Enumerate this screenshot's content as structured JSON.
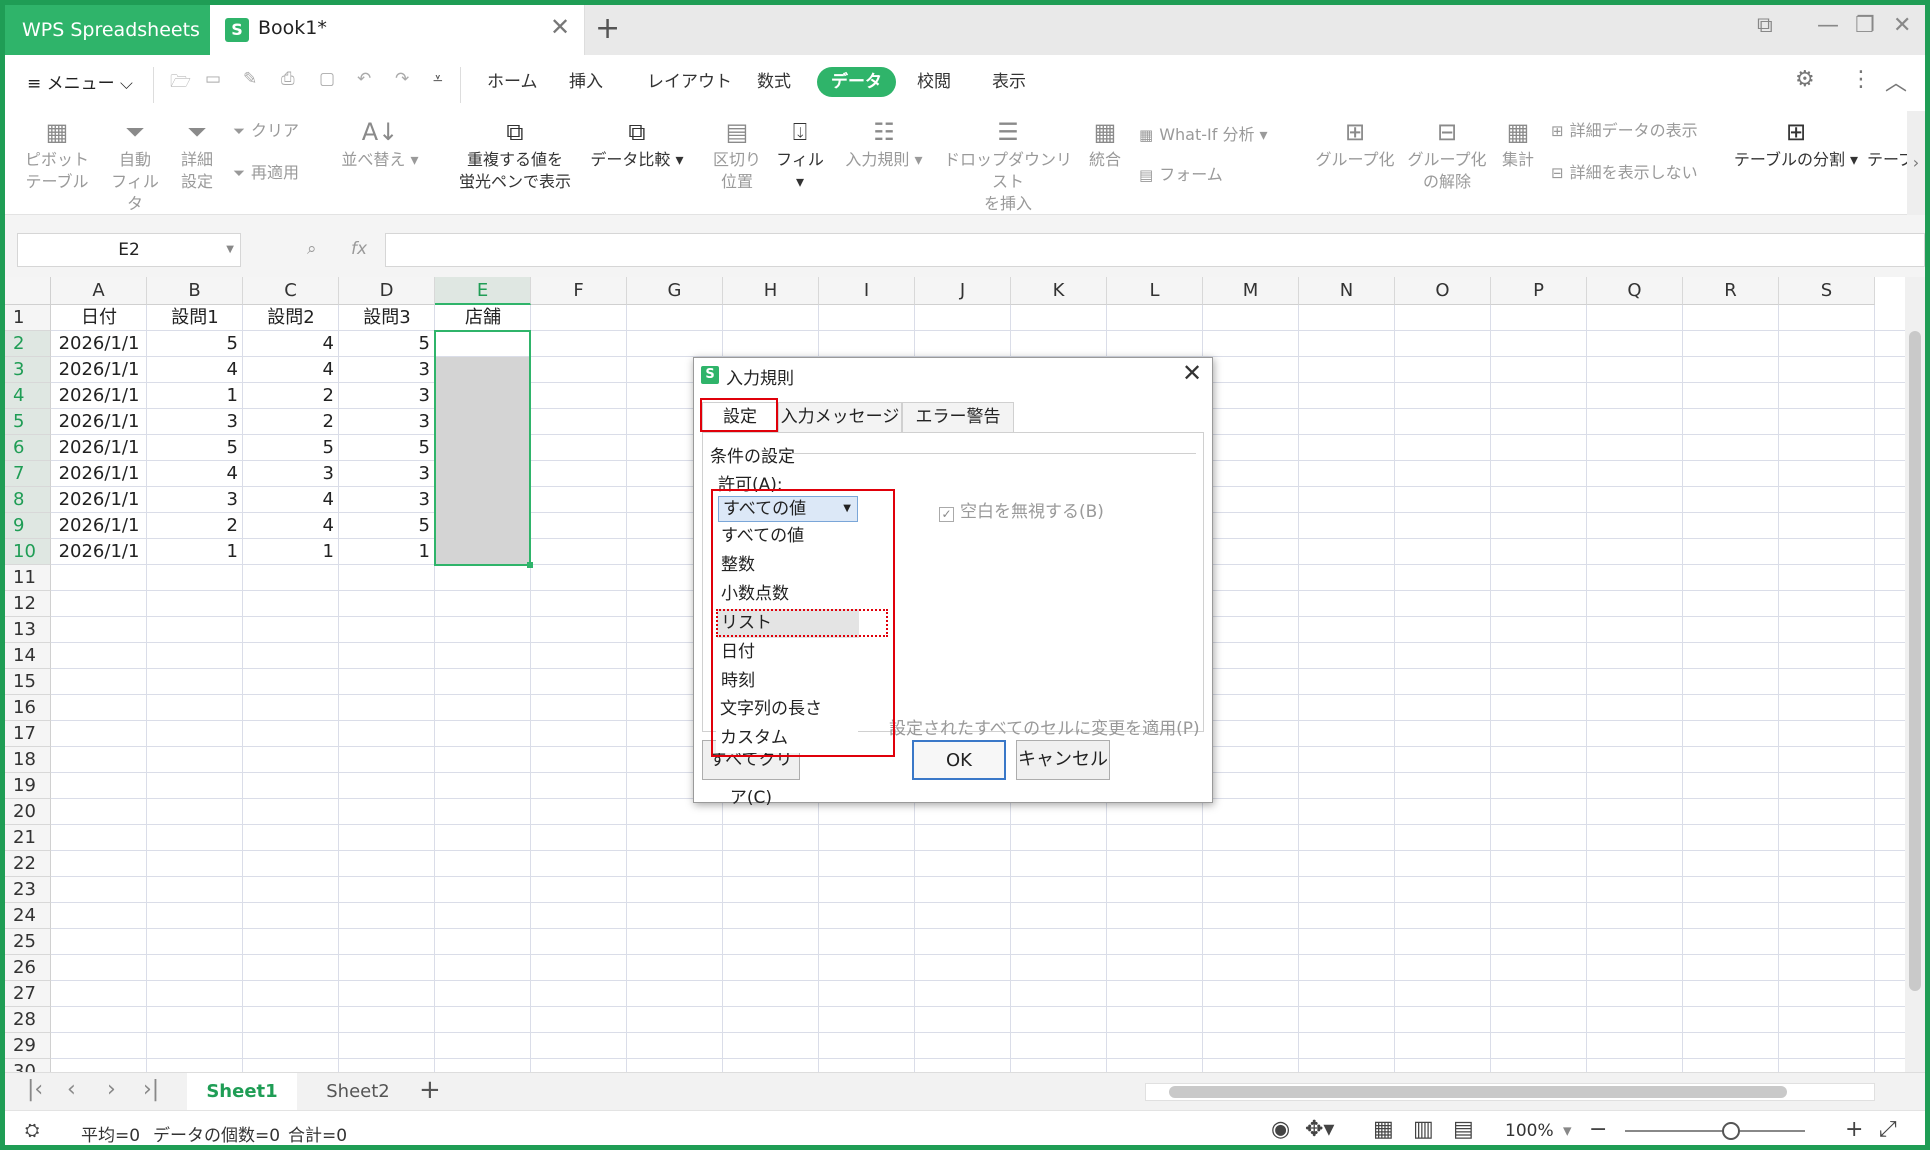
{
  "titlebar": {
    "app_name": "WPS Spreadsheets",
    "doc_title": "Book1*",
    "doc_icon_letter": "S"
  },
  "menubar": {
    "menu_label": "≡ メニュー ⌵",
    "tabs": [
      {
        "label": "ホーム",
        "active": false
      },
      {
        "label": "挿入",
        "active": false
      },
      {
        "label": "レイアウト",
        "active": false
      },
      {
        "label": "数式",
        "active": false
      },
      {
        "label": "データ",
        "active": true
      },
      {
        "label": "校閲",
        "active": false
      },
      {
        "label": "表示",
        "active": false
      }
    ]
  },
  "ribbon": {
    "pivot": "ピボット\nテーブル",
    "autofilter": "自動\nフィルタ",
    "advanced": "詳細\n設定",
    "clear": "クリア",
    "reapply": "再適用",
    "sort": "並べ替え",
    "highlight_dup": "重複する値を\n蛍光ペンで表示",
    "compare": "データ比較",
    "text_to_col": "区切り\n位置",
    "fill": "フィル",
    "validation": "入力規則",
    "dropdown": "ドロップダウンリスト\nを挿入",
    "consolidate": "統合",
    "whatif": "What-If 分析",
    "form": "フォーム",
    "group": "グループ化",
    "ungroup": "グループ化\nの解除",
    "subtotal": "集計",
    "show_detail": "詳細データの表示",
    "hide_detail": "詳細を表示しない",
    "table_split": "テーブルの分割",
    "table_more": "テーブ"
  },
  "formula": {
    "cell_ref": "E2",
    "fx": "fx",
    "value": ""
  },
  "grid": {
    "columns": [
      "A",
      "B",
      "C",
      "D",
      "E",
      "F",
      "G",
      "H",
      "I",
      "J",
      "K",
      "L",
      "M",
      "N",
      "O",
      "P",
      "Q",
      "R",
      "S"
    ],
    "selected_column": "E",
    "row_numbers": [
      "1",
      "2",
      "3",
      "4",
      "5",
      "6",
      "7",
      "8",
      "9",
      "10",
      "11",
      "12",
      "13",
      "14",
      "15",
      "16",
      "17",
      "18",
      "19",
      "20",
      "21",
      "22",
      "23",
      "24",
      "25",
      "26",
      "27",
      "28",
      "29",
      "30"
    ],
    "headers": [
      "日付",
      "設問1",
      "設問2",
      "設問3",
      "店舗"
    ],
    "rows": [
      [
        "2026/1/1",
        "5",
        "4",
        "5"
      ],
      [
        "2026/1/1",
        "4",
        "4",
        "3"
      ],
      [
        "2026/1/1",
        "1",
        "2",
        "3"
      ],
      [
        "2026/1/1",
        "3",
        "2",
        "3"
      ],
      [
        "2026/1/1",
        "5",
        "5",
        "5"
      ],
      [
        "2026/1/1",
        "4",
        "3",
        "3"
      ],
      [
        "2026/1/1",
        "3",
        "4",
        "3"
      ],
      [
        "2026/1/1",
        "2",
        "4",
        "5"
      ],
      [
        "2026/1/1",
        "1",
        "1",
        "1"
      ]
    ]
  },
  "sheets": [
    {
      "label": "Sheet1",
      "active": true
    },
    {
      "label": "Sheet2",
      "active": false
    }
  ],
  "status": {
    "avg": "平均=0",
    "count": "データの個数=0",
    "sum": "合計=0",
    "zoom": "100%"
  },
  "dialog": {
    "title": "入力規則",
    "tabs": [
      "設定",
      "入力メッセージ",
      "エラー警告"
    ],
    "active_tab": "設定",
    "group_label": "条件の設定",
    "allow_label": "許可(A):",
    "selected_value": "すべての値",
    "options": [
      "すべての値",
      "整数",
      "小数点数",
      "リスト",
      "日付",
      "時刻",
      "文字列の長さ",
      "カスタム"
    ],
    "highlighted_option": "リスト",
    "ignore_blank": "空白を無視する(B)",
    "apply_all": "設定されたすべてのセルに変更を適用(P)",
    "clear_btn": "すべてクリア(C)",
    "ok_btn": "OK",
    "cancel_btn": "キャンセル"
  },
  "colors": {
    "accent": "#2fb46a",
    "annotation": "#e0000a",
    "selection_fill": "#d4d4d4"
  }
}
